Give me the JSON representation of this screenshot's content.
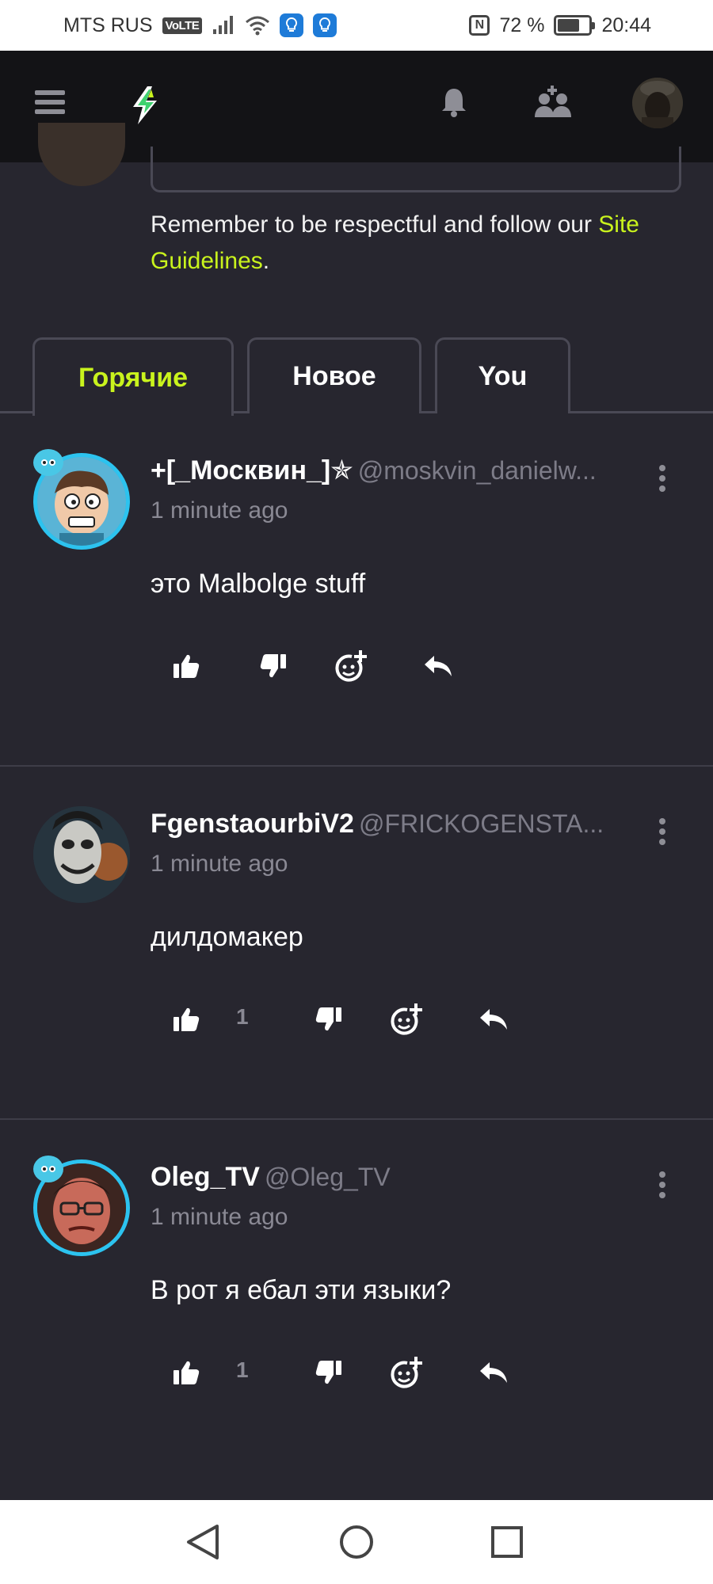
{
  "status_bar": {
    "carrier": "MTS RUS",
    "volte": "VoLTE",
    "battery_percent": "72 %",
    "battery_level": 0.72,
    "time": "20:44"
  },
  "header": {
    "menu_icon": "hamburger-icon",
    "logo_icon": "lightning-logo-icon",
    "notifications_icon": "bell-icon",
    "add_friend_icon": "add-user-icon",
    "accent_color": "#c9f31d"
  },
  "composer": {
    "guidelines_text": "Remember to be respectful and follow our ",
    "guidelines_link": "Site Guidelines",
    "guidelines_end": "."
  },
  "tabs": [
    {
      "label": "Горячие",
      "active": true
    },
    {
      "label": "Новое",
      "active": false
    },
    {
      "label": "You",
      "active": false
    }
  ],
  "comments": [
    {
      "name": "+[_Москвин_]✯",
      "handle": "@moskvin_danielw...",
      "time": "1 minute ago",
      "text": "это Malbolge stuff",
      "likes": ""
    },
    {
      "name": "FgenstaourbiV2",
      "handle": "@FRICKOGENSTA...",
      "time": "1 minute ago",
      "text": "дилдомакер",
      "likes": "1"
    },
    {
      "name": "Oleg_TV",
      "handle": "@Oleg_TV",
      "time": "1 minute ago",
      "text": "В рот я ебал эти языки?",
      "likes": "1"
    }
  ]
}
